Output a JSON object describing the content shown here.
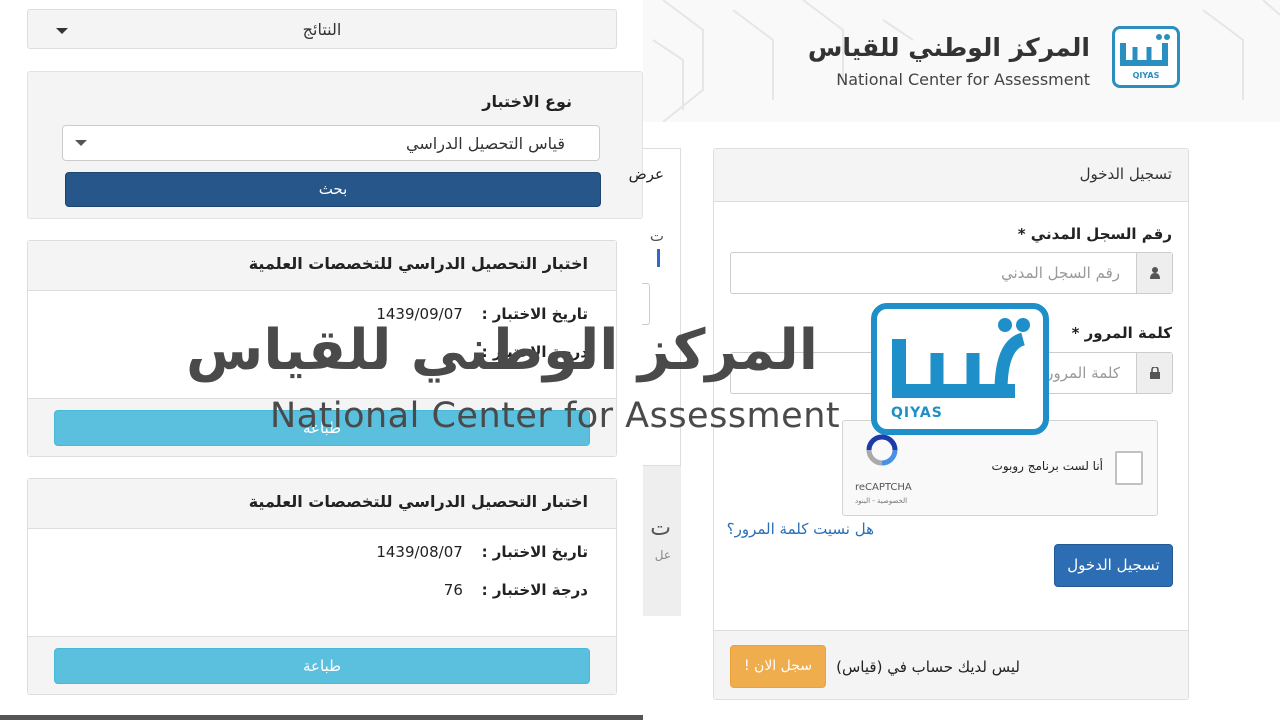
{
  "results_dropdown": {
    "label": "النتائج"
  },
  "test_type": {
    "title": "نوع الاختبار",
    "selected": "قياس التحصيل الدراسي",
    "search_label": "بحث"
  },
  "tests": [
    {
      "title": "اختبار التحصيل الدراسي للتخصصات العلمية",
      "date_label": "تاريخ الاختبار :",
      "date": "1439/09/07",
      "score_label": "درجة الاختبار :",
      "score": "",
      "print_label": "طباعة"
    },
    {
      "title": "اختبار التحصيل الدراسي للتخصصات العلمية",
      "date_label": "تاريخ الاختبار :",
      "date": "1439/08/07",
      "score_label": "درجة الاختبار :",
      "score": "76",
      "print_label": "طباعة"
    }
  ],
  "middle": {
    "cut_title": "عرض",
    "cut_text": "ت",
    "cut_big": "ت",
    "cut_small": "عل"
  },
  "header": {
    "brand_ar": "المركز الوطني للقياس",
    "brand_en": "National Center for Assessment",
    "logo_text": "QIYAS",
    "logo_ar": "قياس"
  },
  "login": {
    "title": "تسجيل الدخول",
    "id_label": "رقم السجل المدني *",
    "id_placeholder": "رقم السجل المدني",
    "password_label": "كلمة المرور *",
    "password_placeholder": "كلمة المرور",
    "captcha_text": "أنا لست برنامج روبوت",
    "captcha_brand": "reCAPTCHA",
    "captcha_terms": "الخصوصية - البنود",
    "forgot_label": "هل نسيت كلمة المرور؟",
    "submit_label": "تسجيل الدخول",
    "no_account_label": "ليس لديك حساب في (قياس)",
    "register_label": "سجل الان !"
  },
  "watermark": {
    "text_ar": "المركز الوطني للقياس",
    "text_en": "National Center for Assessment",
    "logo_text": "QIYAS",
    "logo_ar": "قياس"
  },
  "colors": {
    "primary": "#27568a",
    "info": "#5bc0de",
    "login_blue": "#2d6db3",
    "warning": "#f0ad4e",
    "brand_blue": "#1e8fc8"
  },
  "icons": {
    "user": "user-icon",
    "lock": "lock-icon",
    "recaptcha": "recaptcha-icon",
    "caret": "caret-down-icon"
  }
}
